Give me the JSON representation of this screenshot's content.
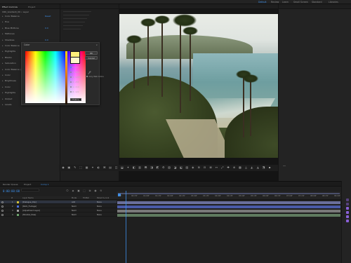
{
  "app": {
    "workspaces": [
      "Default",
      "Review",
      "Learn",
      "Small Screen",
      "Standard",
      "Libraries"
    ],
    "active_workspace": "Default"
  },
  "effects_panel": {
    "tabs": [
      "Effect Controls",
      "Project"
    ],
    "layer": "CR0_Gradient_09 • Layer",
    "rows": [
      {
        "label": "Color Balance",
        "value": "Reset"
      },
      {
        "label": "Hue",
        "value": ""
      },
      {
        "label": "Blue Midtone",
        "value": "0.0"
      },
      {
        "label": "Midtones",
        "value": ""
      },
      {
        "label": "Shadows",
        "value": "0.0"
      },
      {
        "label": "Color Balance",
        "value": ""
      },
      {
        "label": "Highlights",
        "value": "0.0"
      },
      {
        "label": "Blacks",
        "value": ""
      },
      {
        "label": "Saturation",
        "value": "0.0"
      },
      {
        "label": "Color Balance (HLS)",
        "value": "Reset"
      },
      {
        "label": "Color",
        "value": ""
      },
      {
        "label": "Brightness",
        "value": ""
      },
      {
        "label": "Color",
        "value": ""
      },
      {
        "label": "Highlights",
        "value": ""
      },
      {
        "label": "Output",
        "value": ""
      },
      {
        "label": "Levels",
        "value": ""
      }
    ]
  },
  "picker": {
    "title": "Color",
    "close": "×",
    "ok": "OK",
    "cancel": "Cancel",
    "eyedropper_icon": "eyedropper-icon",
    "only_web_colors": "Only Web Colors",
    "channels": [
      {
        "label": "H:",
        "value": "41°",
        "selected": true
      },
      {
        "label": "S:",
        "value": "52%",
        "selected": false
      },
      {
        "label": "B:",
        "value": "100%",
        "selected": false
      },
      {
        "label": "R:",
        "value": "255",
        "selected": false
      },
      {
        "label": "G:",
        "value": "219",
        "selected": false
      },
      {
        "label": "B:",
        "value": "122",
        "selected": false
      }
    ],
    "hex": "FFDB7A",
    "new_color": "#ffef7a",
    "old_color": "#fff7c9"
  },
  "timeline": {
    "tabs": [
      "Render Queue",
      "Project",
      "Comp 1"
    ],
    "timecode": "0:00:00:00",
    "layer_header": {
      "num": "#",
      "name": "Layer Name",
      "mode": "Mode",
      "trkmat": "TrkMat",
      "parent": "Parent & Link"
    },
    "layers": [
      {
        "num": "1",
        "name": "[Dialogue_Clip]",
        "mode": "Add",
        "parent": "None",
        "color": "#d2c13a"
      },
      {
        "num": "2",
        "name": "[Palm_Footage]",
        "mode": "Norm",
        "parent": "None",
        "color": "#4a6fd8"
      },
      {
        "num": "3",
        "name": "[Adjustment Layer]",
        "mode": "Norm",
        "parent": "None",
        "color": "#9f9f9f"
      },
      {
        "num": "4",
        "name": "[Shadow_Pass]",
        "mode": "Norm",
        "parent": "None",
        "color": "#6ca46c"
      }
    ],
    "ruler_labels": [
      "0f",
      "00:15f",
      "01:00f",
      "01:15f",
      "02:00f",
      "02:15f",
      "03:00f",
      "03:15f",
      "04:00f",
      "04:15f",
      "05:00f",
      "05:15f",
      "06:00f",
      "06:15f",
      "07:00f",
      "07:15f",
      "08:00f",
      "08:15f",
      "09:00f"
    ],
    "track_colors": [
      "#6a6f9c",
      "#4a5aa8",
      "#787878",
      "#5f7a5f"
    ]
  },
  "colors": {
    "accent": "#3d8fe8",
    "keyframe": "#8a60d8"
  }
}
